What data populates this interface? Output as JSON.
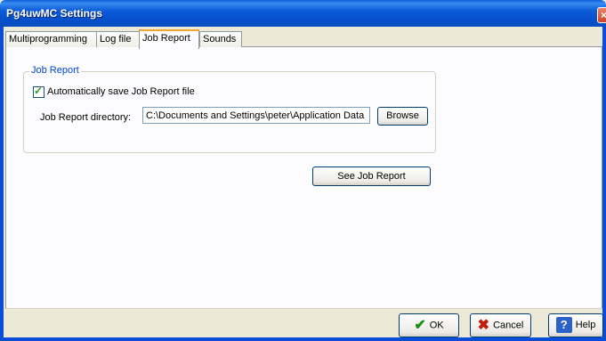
{
  "window": {
    "title": "Pg4uwMC Settings",
    "close_glyph": "×"
  },
  "tabs": [
    {
      "label": "Multiprogramming",
      "active": false
    },
    {
      "label": "Log file",
      "active": false
    },
    {
      "label": "Job Report",
      "active": true
    },
    {
      "label": "Sounds",
      "active": false
    }
  ],
  "job_report_group": {
    "title": "Job Report",
    "auto_save": {
      "label": "Automatically save Job Report file",
      "checked": true
    },
    "directory": {
      "label": "Job Report directory:",
      "value": "C:\\Documents and Settings\\peter\\Application Data",
      "browse_label": "Browse"
    }
  },
  "see_job_report_label": "See Job Report",
  "footer": {
    "ok_label": "OK",
    "cancel_label": "Cancel",
    "help_label": "Help"
  },
  "icons": {
    "ok": "green-checkmark-icon",
    "cancel": "red-x-icon",
    "help": "question-mark-icon",
    "checkbox": "checkmark-icon"
  },
  "colors": {
    "title_bar": "#0a5fd8",
    "window_bg": "#ece9d8",
    "group_title": "#0046d5",
    "active_tab_accent": "#f1a634"
  }
}
